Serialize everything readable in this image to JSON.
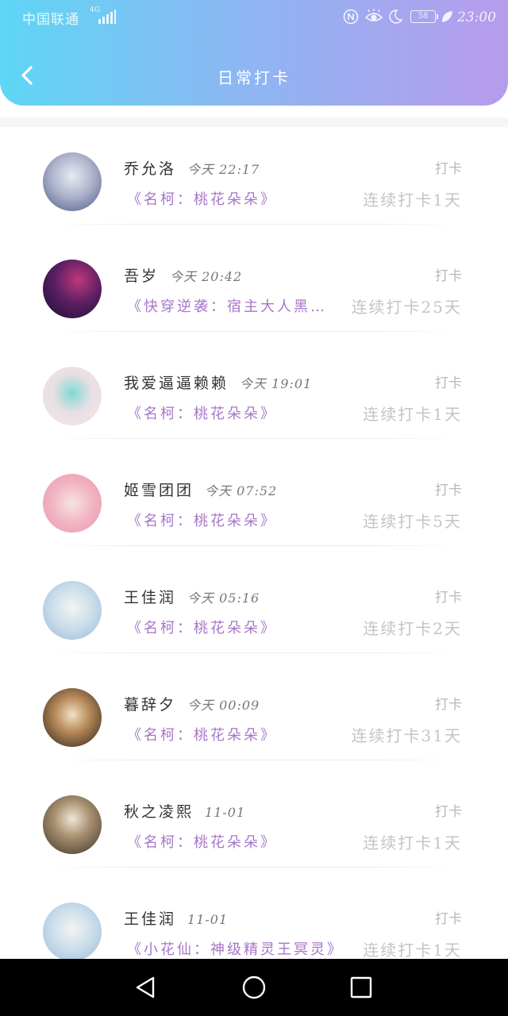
{
  "status_bar": {
    "carrier": "中国联通",
    "network": "4G",
    "battery": "58",
    "time": "23:00",
    "icons": [
      "nfc-icon",
      "eye-comfort-icon",
      "moon-icon",
      "battery-icon",
      "leaf-icon"
    ]
  },
  "header": {
    "title": "日常打卡",
    "back_icon": "chevron-left-icon",
    "gradient": [
      "#5ed6f5",
      "#b79bec"
    ]
  },
  "checkins": [
    {
      "name": "乔允洛",
      "time": "今天  22:17",
      "book": "《名柯：桃花朵朵》",
      "action": "打卡",
      "streak": "连续打卡1天"
    },
    {
      "name": "吾岁",
      "time": "今天  20:42",
      "book": "《快穿逆袭：宿主大人黑…",
      "action": "打卡",
      "streak": "连续打卡25天"
    },
    {
      "name": "我爱逼逼赖赖",
      "time": "今天  19:01",
      "book": "《名柯：桃花朵朵》",
      "action": "打卡",
      "streak": "连续打卡1天"
    },
    {
      "name": "姬雪团团",
      "time": "今天  07:52",
      "book": "《名柯：桃花朵朵》",
      "action": "打卡",
      "streak": "连续打卡5天"
    },
    {
      "name": "王佳润",
      "time": "今天  05:16",
      "book": "《名柯：桃花朵朵》",
      "action": "打卡",
      "streak": "连续打卡2天"
    },
    {
      "name": "暮辞夕",
      "time": "今天  00:09",
      "book": "《名柯：桃花朵朵》",
      "action": "打卡",
      "streak": "连续打卡31天"
    },
    {
      "name": "秋之凌熙",
      "time": "11-01",
      "book": "《名柯：桃花朵朵》",
      "action": "打卡",
      "streak": "连续打卡1天"
    },
    {
      "name": "王佳润",
      "time": "11-01",
      "book": "《小花仙：神级精灵王冥灵》",
      "action": "打卡",
      "streak": "连续打卡1天"
    }
  ],
  "colors": {
    "book_title": "#a776c9",
    "streak": "#c4c4c4"
  },
  "nav_bar": {
    "icons": [
      "back-triangle-icon",
      "home-circle-icon",
      "recents-square-icon"
    ]
  }
}
